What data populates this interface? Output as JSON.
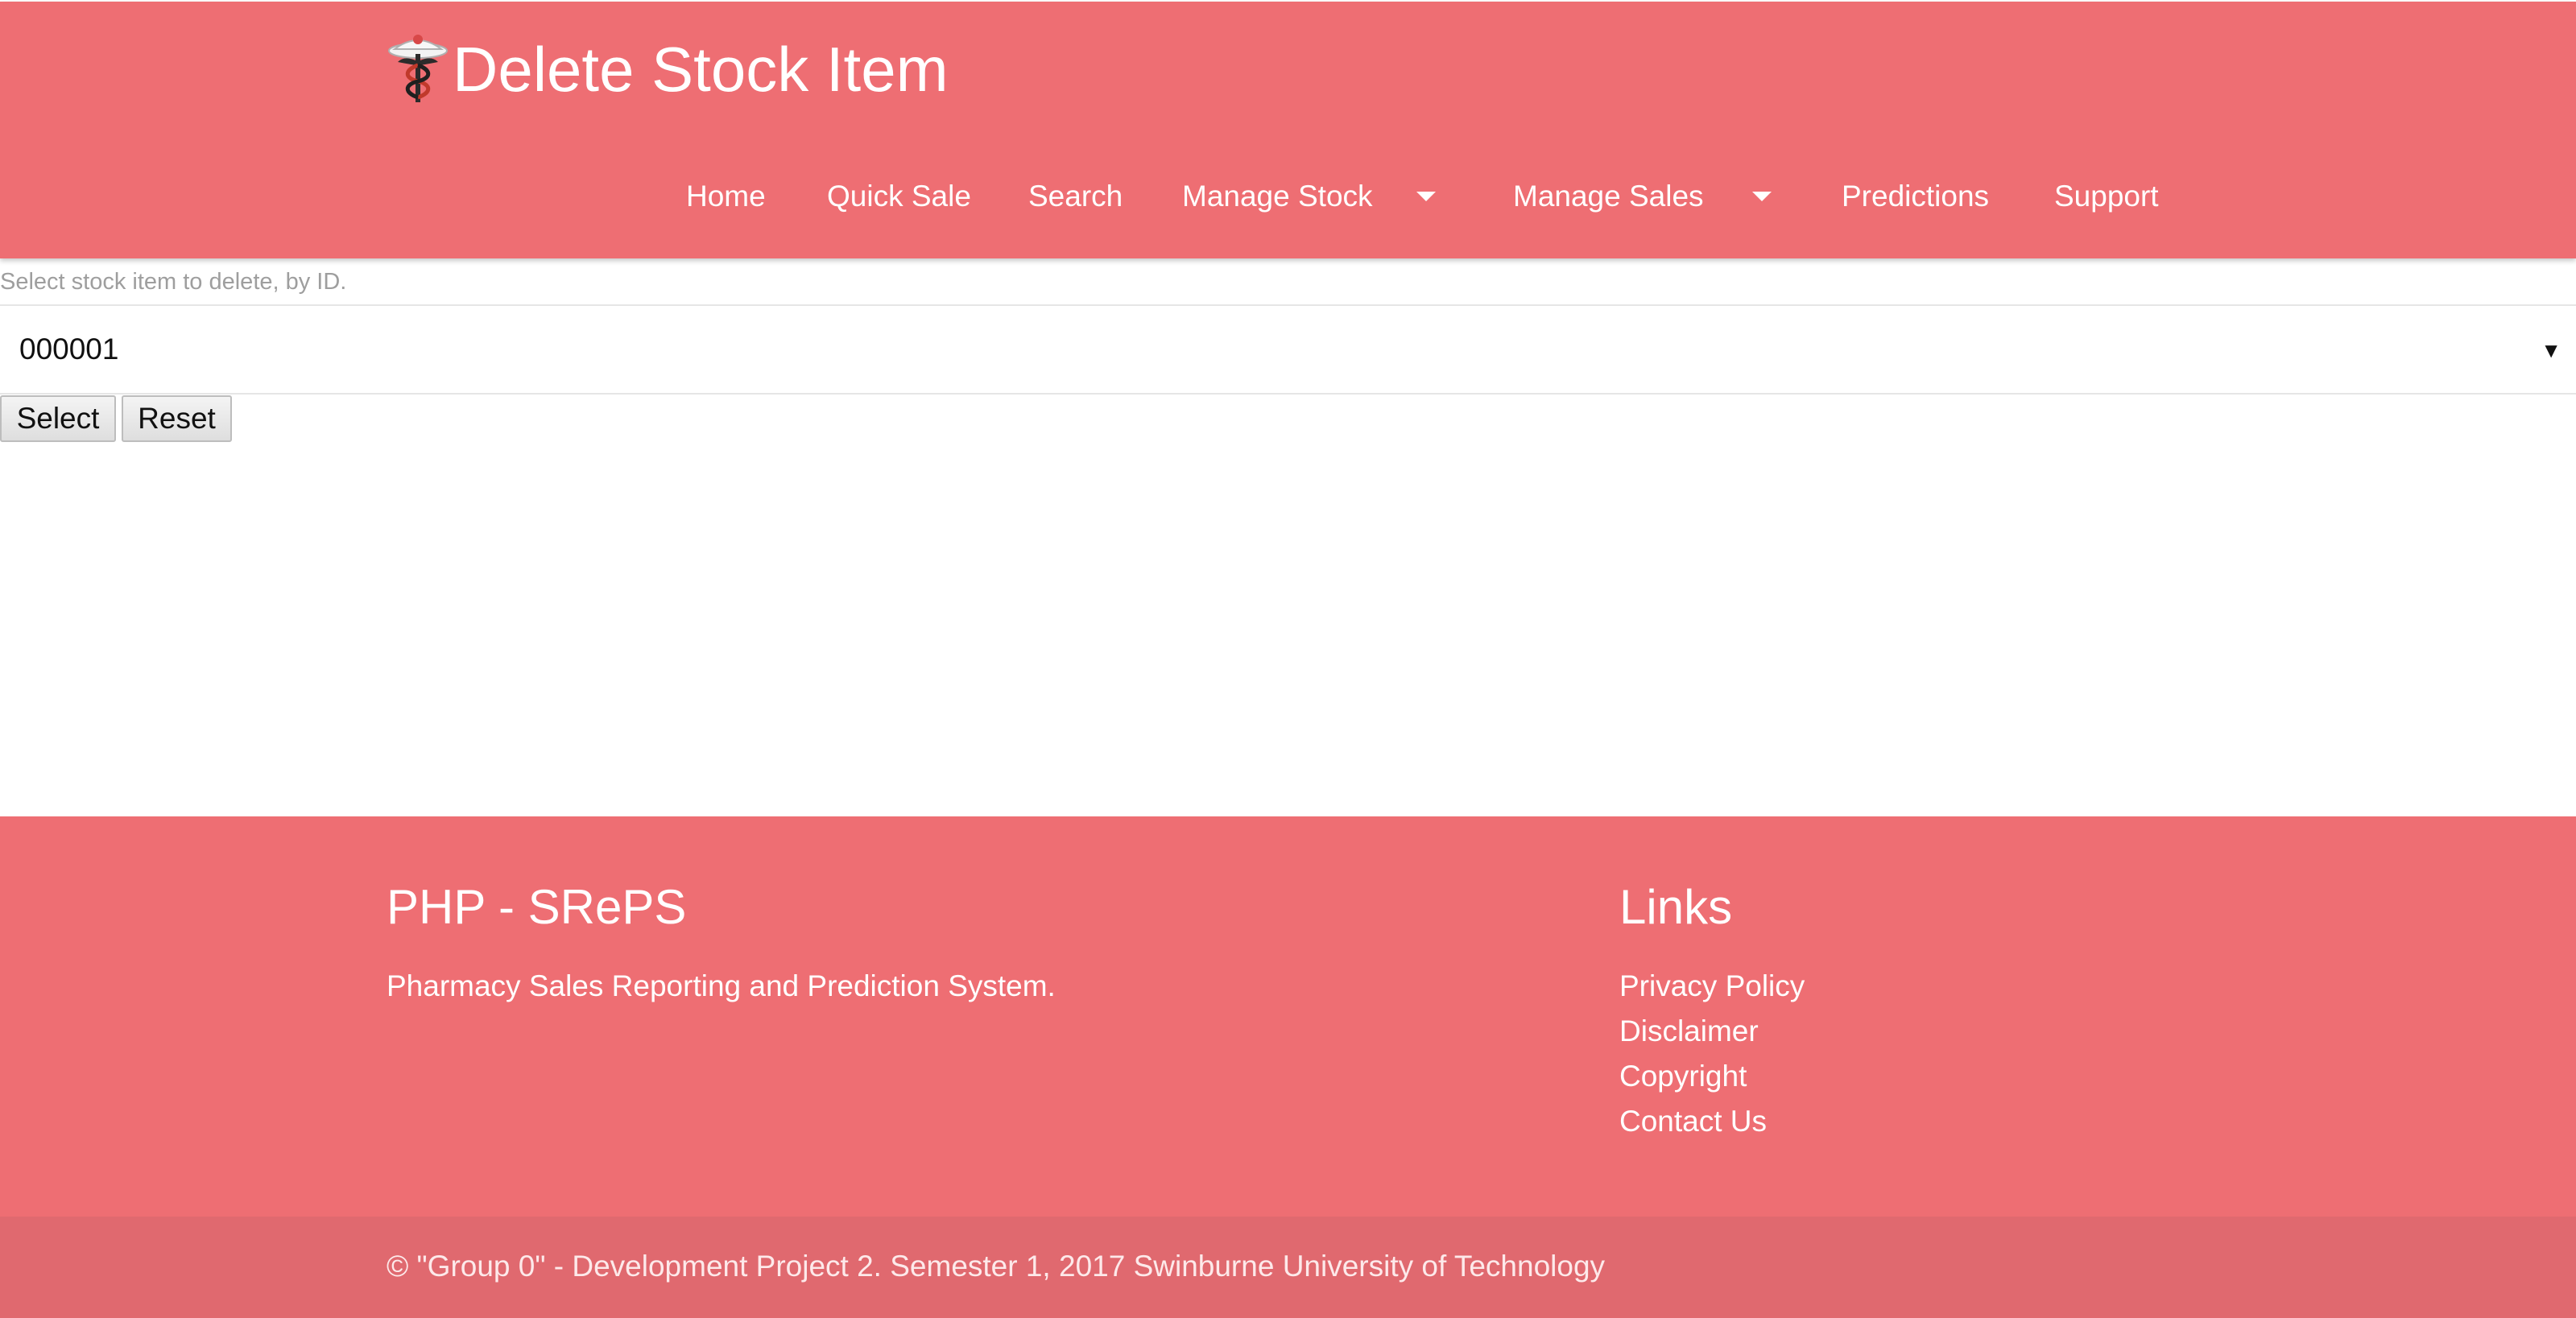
{
  "header": {
    "title": "Delete Stock Item",
    "logo_icon": "caduceus-icon",
    "background_color": "#ee6e73"
  },
  "nav": {
    "items": [
      {
        "label": "Home"
      },
      {
        "label": "Quick Sale"
      },
      {
        "label": "Search"
      },
      {
        "label": "Manage Stock",
        "dropdown_icon": "caret-down-icon"
      },
      {
        "label": "Manage Sales",
        "dropdown_icon": "caret-down-icon"
      },
      {
        "label": "Predictions"
      },
      {
        "label": "Support"
      }
    ]
  },
  "form": {
    "label": "Select stock item to delete, by ID.",
    "selected_id": "000001",
    "arrow_icon": "dropdown-arrow-icon",
    "select_button": "Select",
    "reset_button": "Reset"
  },
  "footer": {
    "brand_heading": "PHP - SRePS",
    "brand_description": "Pharmacy Sales Reporting and Prediction System.",
    "links_heading": "Links",
    "links": [
      {
        "label": "Privacy Policy"
      },
      {
        "label": "Disclaimer"
      },
      {
        "label": "Copyright"
      },
      {
        "label": "Contact Us"
      }
    ],
    "copyright": "© \"Group 0\" - Development Project 2. Semester 1, 2017 Swinburne University of Technology"
  }
}
